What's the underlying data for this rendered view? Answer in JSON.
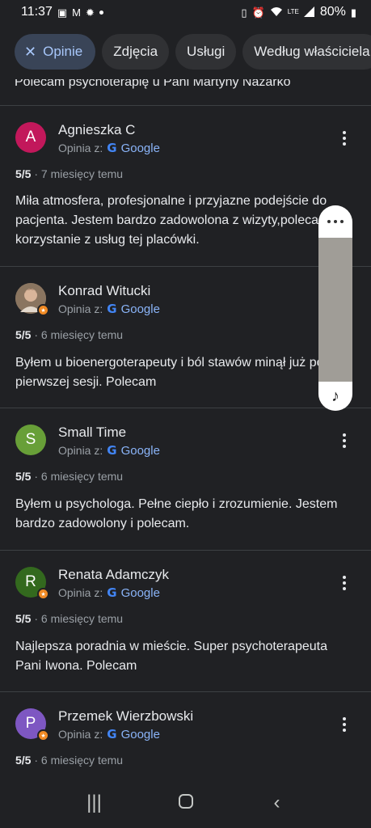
{
  "status_bar": {
    "time": "11:37",
    "left_icons": [
      "image-icon",
      "gmail-icon",
      "settings-icon",
      "dot-icon"
    ],
    "right_icons": [
      "sim-icon",
      "alarm-icon",
      "wifi-icon",
      "volte-icon",
      "signal-icon"
    ],
    "battery": "80%"
  },
  "chips": [
    {
      "label": "Opinie",
      "active": true
    },
    {
      "label": "Zdjęcia",
      "active": false
    },
    {
      "label": "Usługi",
      "active": false
    },
    {
      "label": "Według właściciela",
      "active": false
    }
  ],
  "partial_text": "Polecam psychoterapię u Pani Martyny Nazarko",
  "source_prefix": "Opinia z:",
  "source_name": "Google",
  "reviews": [
    {
      "initial": "A",
      "avatar_color": "#c2185b",
      "badge": false,
      "author": "Agnieszka C",
      "rating": "5/5",
      "time": "7 miesięcy temu",
      "text": "Miła atmosfera, profesjonalne i przyjazne podejście do pacjenta. Jestem bardzo zadowolona z wizyty,polecam korzystanie z usług tej placówki."
    },
    {
      "initial": "",
      "avatar_color": "#7a6a58",
      "badge": true,
      "author": "Konrad Witucki",
      "rating": "5/5",
      "time": "6 miesięcy temu",
      "text": "Byłem u bioenergoterapeuty i ból stawów minął już po pierwszej sesji. Polecam"
    },
    {
      "initial": "S",
      "avatar_color": "#689f38",
      "badge": false,
      "author": "Small Time",
      "rating": "5/5",
      "time": "6 miesięcy temu",
      "text": "Byłem u psychologa. Pełne ciepło i zrozumienie. Jestem bardzo zadowolony i polecam."
    },
    {
      "initial": "R",
      "avatar_color": "#33691e",
      "badge": true,
      "author": "Renata Adamczyk",
      "rating": "5/5",
      "time": "6 miesięcy temu",
      "text": "Najlepsza poradnia w mieście. Super psychoterapeuta Pani Iwona. Polecam"
    },
    {
      "initial": "P",
      "avatar_color": "#7e57c2",
      "badge": true,
      "author": "Przemek Wierzbowski",
      "rating": "5/5",
      "time": "6 miesięcy temu",
      "text": ""
    }
  ],
  "nav": [
    "recent-apps-icon",
    "home-icon",
    "back-icon"
  ]
}
